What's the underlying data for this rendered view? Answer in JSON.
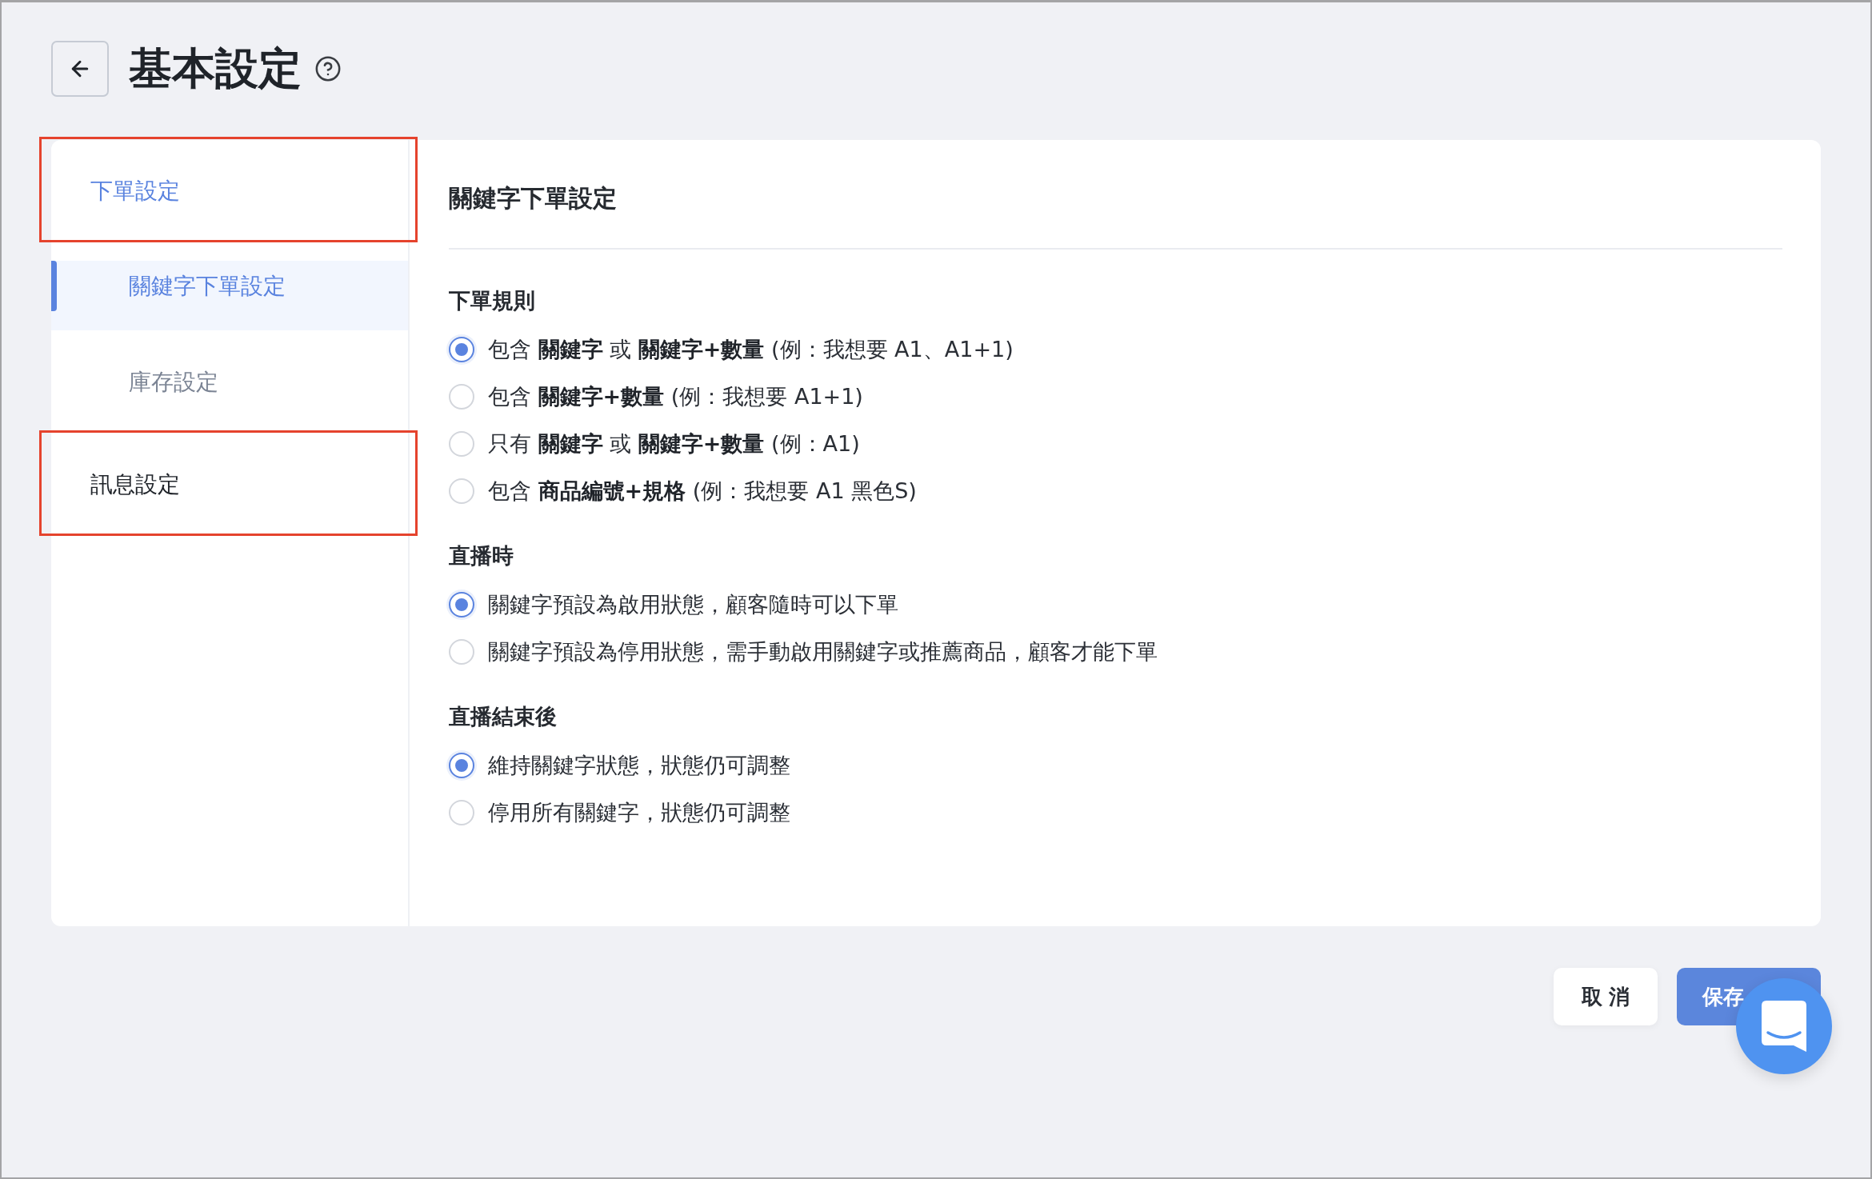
{
  "page": {
    "title": "基本設定"
  },
  "sidebar": {
    "items": [
      {
        "label": "下單設定",
        "selected": true,
        "highlighted": true,
        "children": [
          {
            "label": "關鍵字下單設定",
            "selected": true,
            "highlighted": false
          },
          {
            "label": "庫存設定",
            "selected": false,
            "highlighted": false
          }
        ]
      },
      {
        "label": "訊息設定",
        "selected": false,
        "highlighted": true
      }
    ]
  },
  "panel": {
    "title": "關鍵字下單設定",
    "sections": [
      {
        "heading": "下單規則",
        "options": [
          {
            "label": "包含 **關鍵字** 或 **關鍵字+數量** (例：我想要 A1、A1+1)",
            "selected": true
          },
          {
            "label": "包含 **關鍵字+數量** (例：我想要 A1+1)",
            "selected": false
          },
          {
            "label": "只有 **關鍵字** 或 **關鍵字+數量** (例：A1)",
            "selected": false
          },
          {
            "label": "包含 **商品編號+規格** (例：我想要 A1 黑色S)",
            "selected": false
          }
        ]
      },
      {
        "heading": "直播時",
        "options": [
          {
            "label": "關鍵字預設為啟用狀態，顧客隨時可以下單",
            "selected": true
          },
          {
            "label": "關鍵字預設為停用狀態，需手動啟用關鍵字或推薦商品，顧客才能下單",
            "selected": false
          }
        ]
      },
      {
        "heading": "直播結束後",
        "options": [
          {
            "label": "維持關鍵字狀態，狀態仍可調整",
            "selected": true
          },
          {
            "label": "停用所有關鍵字，狀態仍可調整",
            "selected": false
          }
        ]
      }
    ]
  },
  "footer": {
    "buttons": [
      {
        "label": "取消",
        "kind": "secondary"
      },
      {
        "label": "保存",
        "kind": "primary"
      }
    ]
  }
}
